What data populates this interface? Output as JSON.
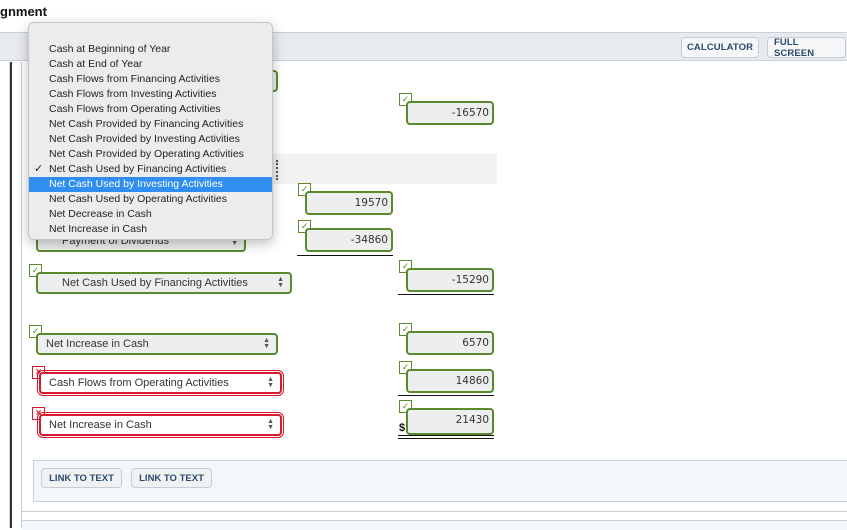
{
  "page": {
    "title": "gnment"
  },
  "toolbar": {
    "calculator_label": "CALCULATOR",
    "fullscreen_label": "FULL SCREEN"
  },
  "dropdown": {
    "options": [
      {
        "label": "Cash at Beginning of Year",
        "checked": false,
        "highlighted": false
      },
      {
        "label": "Cash at End of Year",
        "checked": false,
        "highlighted": false
      },
      {
        "label": "Cash Flows from Financing Activities",
        "checked": false,
        "highlighted": false
      },
      {
        "label": "Cash Flows from Investing Activities",
        "checked": false,
        "highlighted": false
      },
      {
        "label": "Cash Flows from Operating Activities",
        "checked": false,
        "highlighted": false
      },
      {
        "label": "Net Cash Provided by Financing Activities",
        "checked": false,
        "highlighted": false
      },
      {
        "label": "Net Cash Provided by Investing Activities",
        "checked": false,
        "highlighted": false
      },
      {
        "label": "Net Cash Provided by Operating Activities",
        "checked": false,
        "highlighted": false
      },
      {
        "label": "Net Cash Used by Financing Activities",
        "checked": true,
        "highlighted": false
      },
      {
        "label": "Net Cash Used by Investing Activities",
        "checked": false,
        "highlighted": true
      },
      {
        "label": "Net Cash Used by Operating Activities",
        "checked": false,
        "highlighted": false
      },
      {
        "label": "Net Decrease in Cash",
        "checked": false,
        "highlighted": false
      },
      {
        "label": "Net Increase in Cash",
        "checked": false,
        "highlighted": false
      }
    ],
    "check_glyph": "✓"
  },
  "rows": {
    "investing_total": {
      "value": "-16570",
      "status": "correct"
    },
    "financing_item_1": {
      "value": "19570",
      "status": "correct"
    },
    "payment_of_dividends": {
      "label": "Payment of Dividends",
      "value": "-34860",
      "status": "correct"
    },
    "financing_total": {
      "label": "Net Cash Used by Financing Activities",
      "value": "-15290",
      "status": "correct"
    },
    "net_increase": {
      "label": "Net Increase in Cash",
      "value": "6570",
      "status": "correct"
    },
    "cash_beginning": {
      "label": "Cash Flows from Operating Activities",
      "value": "14860",
      "status": "incorrect"
    },
    "cash_end": {
      "label": "Net Increase in Cash",
      "value": "21430",
      "status": "incorrect",
      "currency": "$"
    }
  },
  "icons": {
    "check": "✓",
    "x": "×",
    "up_down": [
      "▲",
      "▼"
    ]
  },
  "links": {
    "link1_label": "LINK TO TEXT",
    "link2_label": "LINK TO TEXT"
  }
}
